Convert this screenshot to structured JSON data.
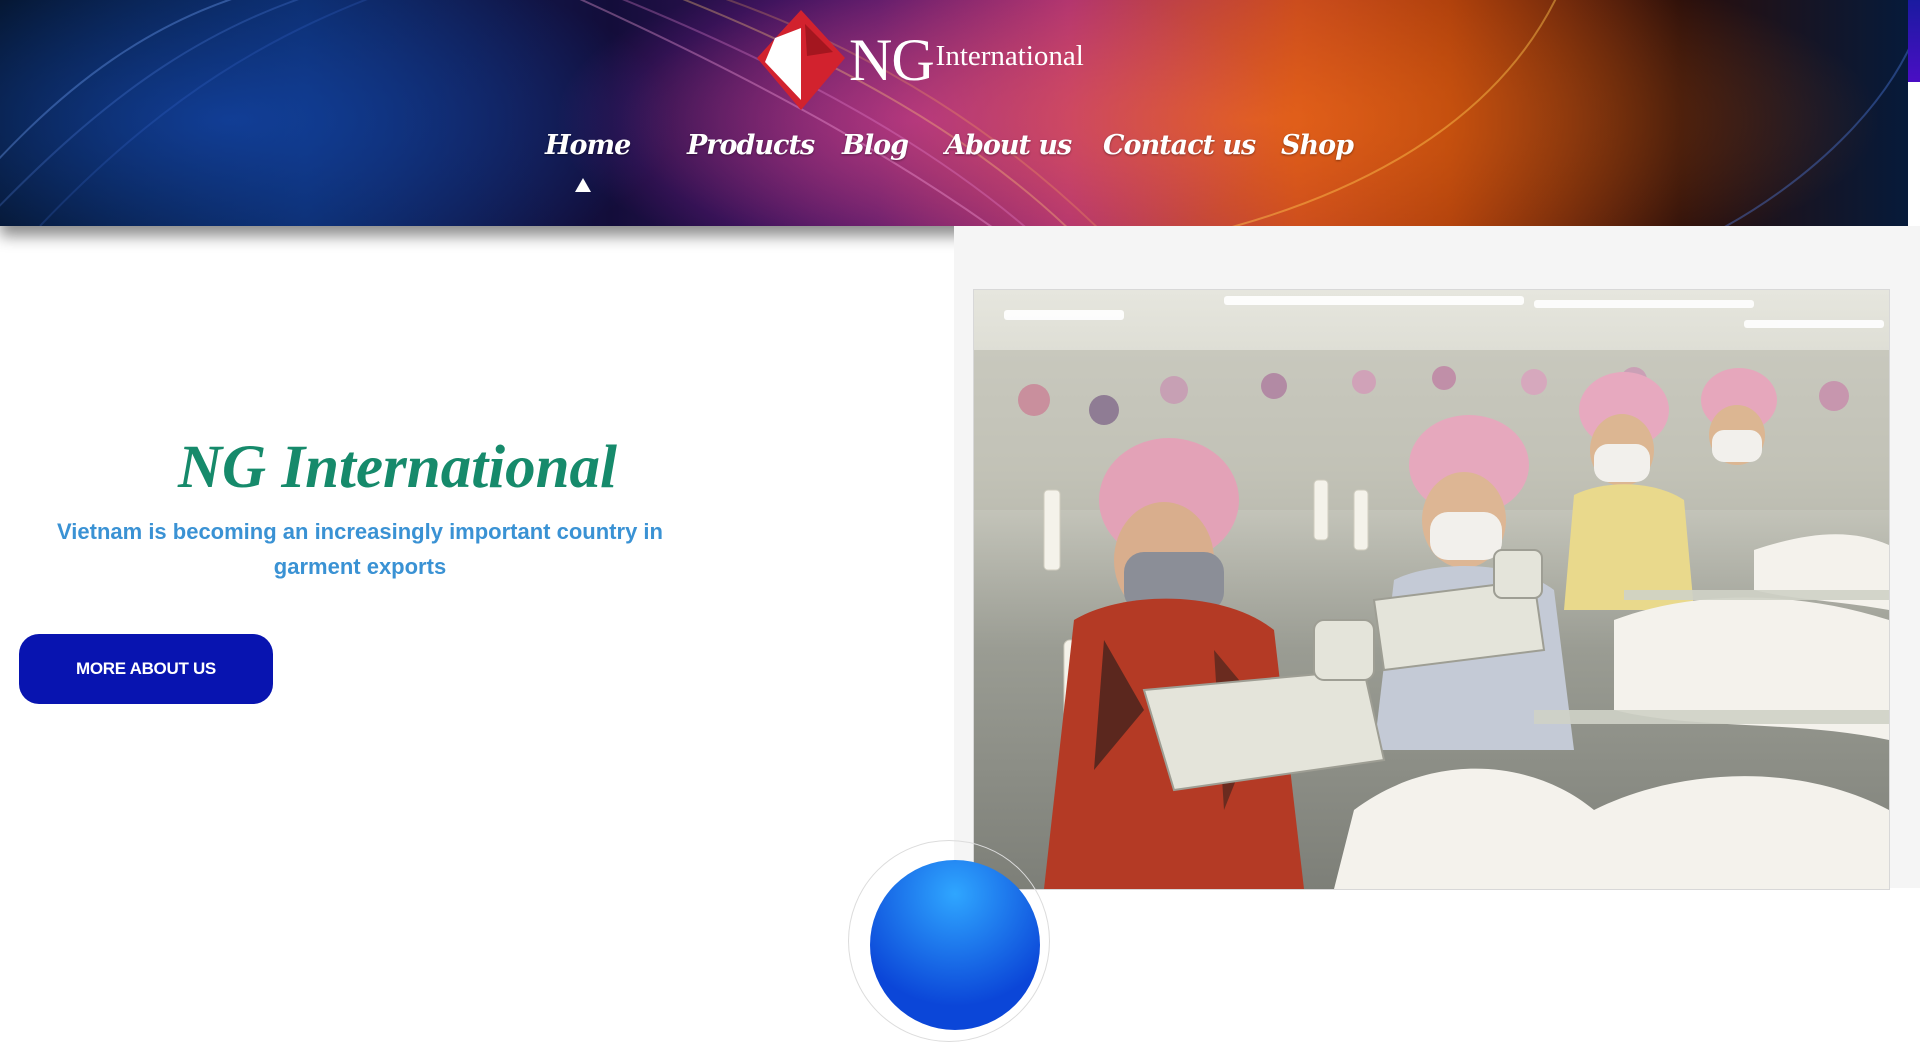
{
  "brand": {
    "logo_ng": "NG",
    "logo_suffix": "International"
  },
  "nav": {
    "items": [
      {
        "label": "Home",
        "active": true
      },
      {
        "label": "Products"
      },
      {
        "label": "Blog"
      },
      {
        "label": "About us"
      },
      {
        "label": "Contact us"
      },
      {
        "label": "Shop"
      }
    ]
  },
  "hero": {
    "title": "NG International",
    "subtitle": "Vietnam is becoming an increasingly important country in garment exports",
    "cta_label": "MORE ABOUT US"
  },
  "colors": {
    "title_green": "#168a6b",
    "subtitle_blue": "#3a92d4",
    "button_blue": "#0814b0",
    "logo_red": "#d2222e"
  }
}
